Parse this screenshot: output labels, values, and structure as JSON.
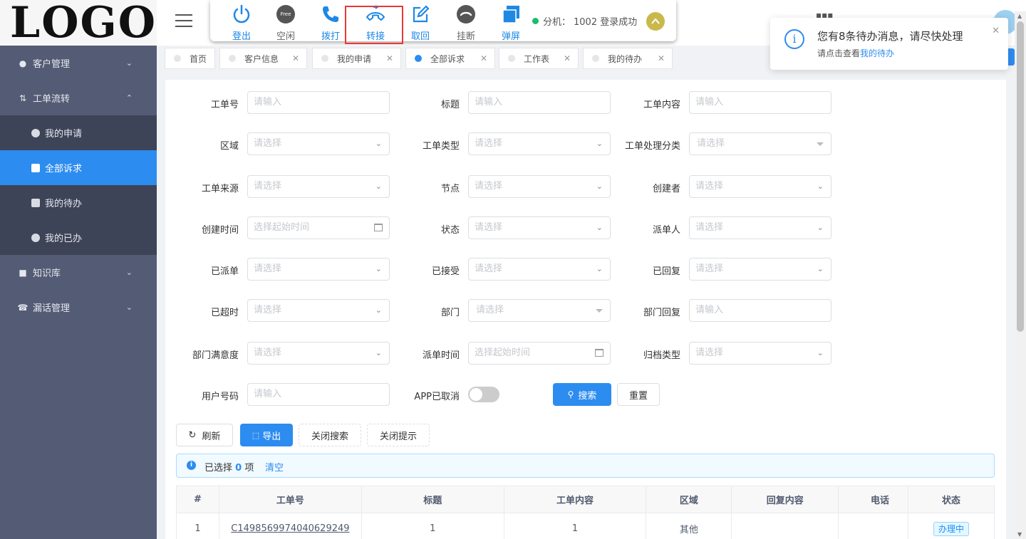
{
  "logo": "LOGO",
  "sidebar": {
    "items": [
      {
        "label": "客户管理"
      },
      {
        "label": "工单流转"
      },
      {
        "label": "知识库"
      },
      {
        "label": "漏话管理"
      }
    ],
    "sub_items": [
      {
        "label": "我的申请"
      },
      {
        "label": "全部诉求"
      },
      {
        "label": "我的待办"
      },
      {
        "label": "我的已办"
      }
    ]
  },
  "toolbar": {
    "buttons": [
      {
        "label": "登出",
        "icon": "power-icon"
      },
      {
        "label": "空闲",
        "icon": "free-icon",
        "badge": "Free"
      },
      {
        "label": "拨打",
        "icon": "phone-icon"
      },
      {
        "label": "转接",
        "icon": "transfer-icon"
      },
      {
        "label": "取回",
        "icon": "edit-icon"
      },
      {
        "label": "挂断",
        "icon": "hangup-icon"
      },
      {
        "label": "弹屏",
        "icon": "popup-icon"
      }
    ],
    "ext_label": "分机：",
    "ext_value": "1002 登录成功"
  },
  "tabs": [
    {
      "label": "首页"
    },
    {
      "label": "客户信息"
    },
    {
      "label": "我的申请"
    },
    {
      "label": "全部诉求"
    },
    {
      "label": "工作表"
    },
    {
      "label": "我的待办"
    }
  ],
  "notification": {
    "title": "您有8条待办消息，请尽快处理",
    "desc_prefix": "请点击查看",
    "desc_link": "我的待办"
  },
  "form": {
    "fields": [
      {
        "label": "工单号",
        "placeholder": "请输入"
      },
      {
        "label": "标题",
        "placeholder": "请输入"
      },
      {
        "label": "工单内容",
        "placeholder": "请输入"
      },
      {
        "label": "区域",
        "placeholder": "请选择"
      },
      {
        "label": "工单类型",
        "placeholder": "请选择"
      },
      {
        "label": "工单处理分类",
        "placeholder": "请选择"
      },
      {
        "label": "工单来源",
        "placeholder": "请选择"
      },
      {
        "label": "节点",
        "placeholder": "请选择"
      },
      {
        "label": "创建者",
        "placeholder": "请选择"
      },
      {
        "label": "创建时间",
        "placeholder": "选择起始时间"
      },
      {
        "label": "状态",
        "placeholder": "请选择"
      },
      {
        "label": "派单人",
        "placeholder": "请选择"
      },
      {
        "label": "已派单",
        "placeholder": "请选择"
      },
      {
        "label": "已接受",
        "placeholder": "请选择"
      },
      {
        "label": "已回复",
        "placeholder": "请选择"
      },
      {
        "label": "已超时",
        "placeholder": "请选择"
      },
      {
        "label": "部门",
        "placeholder": "请选择"
      },
      {
        "label": "部门回复",
        "placeholder": "请输入"
      },
      {
        "label": "部门满意度",
        "placeholder": "请选择"
      },
      {
        "label": "派单时间",
        "placeholder": "选择起始时间"
      },
      {
        "label": "归档类型",
        "placeholder": "请选择"
      },
      {
        "label": "用户号码",
        "placeholder": "请输入"
      }
    ],
    "app_cancel_label": "APP已取消",
    "search_label": "搜索",
    "reset_label": "重置"
  },
  "actions": {
    "refresh": "刷新",
    "export": "导出",
    "close_search": "关闭搜索",
    "close_tip": "关闭提示"
  },
  "selection": {
    "prefix": "已选择",
    "count": "0",
    "suffix": "项",
    "clear": "清空"
  },
  "table": {
    "headers": [
      "#",
      "工单号",
      "标题",
      "工单内容",
      "区域",
      "回复内容",
      "电话",
      "状态"
    ],
    "rows": [
      {
        "index": "1",
        "order_no": "C1498569974040629249",
        "title": "1",
        "content": "1",
        "region": "其他",
        "reply": "",
        "phone": "",
        "status": "办理中"
      }
    ]
  }
}
